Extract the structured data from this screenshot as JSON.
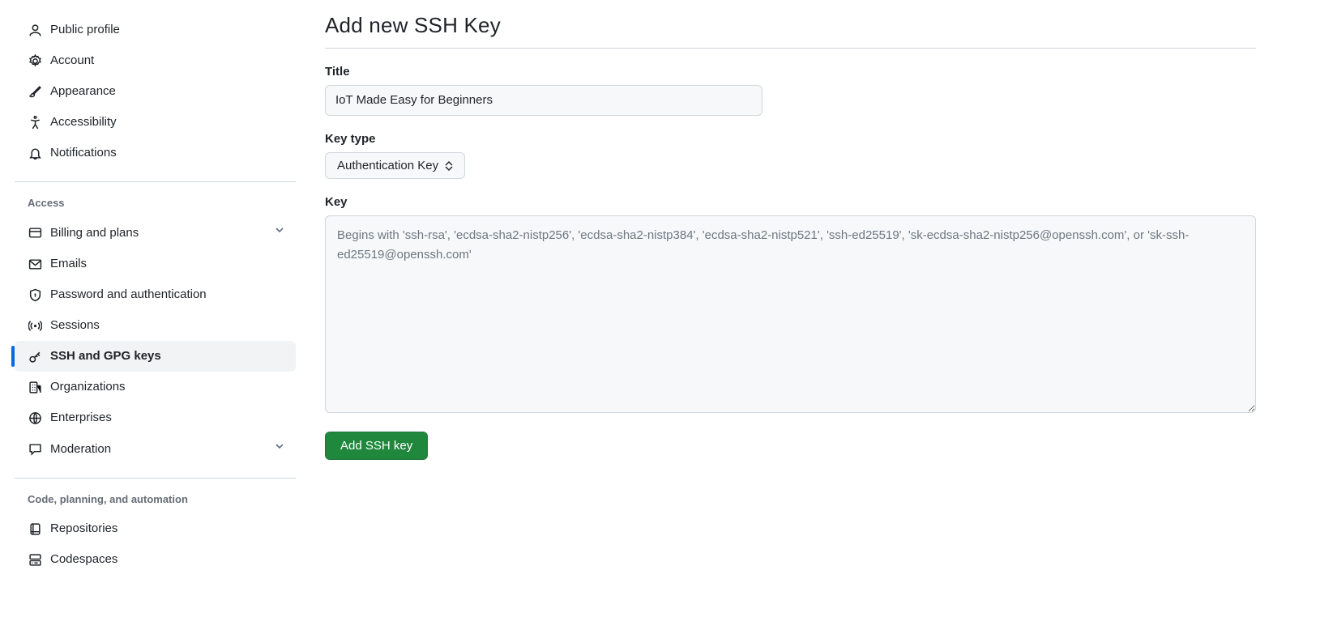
{
  "sidebar": {
    "general": [
      {
        "label": "Public profile",
        "icon": "person"
      },
      {
        "label": "Account",
        "icon": "gear"
      },
      {
        "label": "Appearance",
        "icon": "paintbrush"
      },
      {
        "label": "Accessibility",
        "icon": "accessibility"
      },
      {
        "label": "Notifications",
        "icon": "bell"
      }
    ],
    "access_heading": "Access",
    "access": [
      {
        "label": "Billing and plans",
        "icon": "credit-card",
        "expandable": true
      },
      {
        "label": "Emails",
        "icon": "mail"
      },
      {
        "label": "Password and authentication",
        "icon": "shield-lock"
      },
      {
        "label": "Sessions",
        "icon": "broadcast"
      },
      {
        "label": "SSH and GPG keys",
        "icon": "key",
        "active": true
      },
      {
        "label": "Organizations",
        "icon": "organization"
      },
      {
        "label": "Enterprises",
        "icon": "globe"
      },
      {
        "label": "Moderation",
        "icon": "comment",
        "expandable": true
      }
    ],
    "code_heading": "Code, planning, and automation",
    "code": [
      {
        "label": "Repositories",
        "icon": "repo"
      },
      {
        "label": "Codespaces",
        "icon": "codespaces"
      }
    ]
  },
  "main": {
    "title": "Add new SSH Key",
    "title_label": "Title",
    "title_value": "IoT Made Easy for Beginners",
    "keytype_label": "Key type",
    "keytype_value": "Authentication Key",
    "key_label": "Key",
    "key_placeholder": "Begins with 'ssh-rsa', 'ecdsa-sha2-nistp256', 'ecdsa-sha2-nistp384', 'ecdsa-sha2-nistp521', 'ssh-ed25519', 'sk-ecdsa-sha2-nistp256@openssh.com', or 'sk-ssh-ed25519@openssh.com'",
    "submit_label": "Add SSH key"
  }
}
